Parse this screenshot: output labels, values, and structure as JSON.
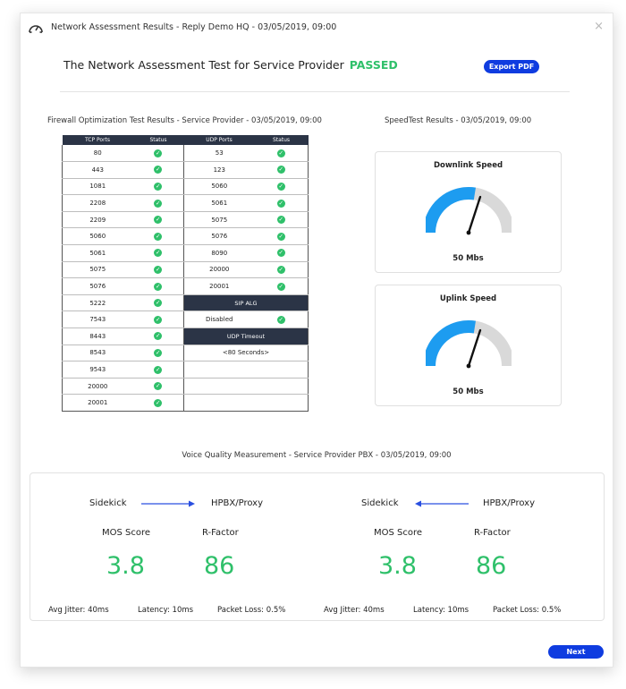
{
  "window": {
    "title": "Network Assessment Results -  Reply Demo HQ - 03/05/2019, 09:00",
    "close_label": "×"
  },
  "header": {
    "headline": "The Network Assessment Test for Service Provider",
    "status": "PASSED",
    "export_label": "Export PDF"
  },
  "firewall": {
    "title": "Firewall Optimization Test Results -  Service Provider - 03/05/2019, 09:00",
    "columns": [
      "TCP Ports",
      "Status",
      "UDP Ports",
      "Status"
    ],
    "tcp_ports": [
      "80",
      "443",
      "1081",
      "2208",
      "2209",
      "5060",
      "5061",
      "5075",
      "5076",
      "5222",
      "7543",
      "8443",
      "8543",
      "9543",
      "20000",
      "20001"
    ],
    "udp_ports": [
      "53",
      "123",
      "5060",
      "5061",
      "5075",
      "5076",
      "8090",
      "20000",
      "20001"
    ],
    "sip_alg_header": "SIP ALG",
    "sip_alg_value": "Disabled",
    "udp_timeout_header": "UDP Timeout",
    "udp_timeout_value": "<80 Seconds>",
    "check_glyph": "✓",
    "status_color": "#2fc06a"
  },
  "speedtest": {
    "title": "SpeedTest Results - 03/05/2019, 09:00",
    "downlink": {
      "title": "Downlink Speed",
      "value": "50 Mbs",
      "level": 0.55
    },
    "uplink": {
      "title": "Uplink Speed",
      "value": "50 Mbs",
      "level": 0.55
    },
    "gauge_fill_color": "#1d9cf0",
    "gauge_track_color": "#d9d9d9"
  },
  "voice": {
    "title": "Voice Quality Measurement - Service Provider PBX - 03/05/2019, 09:00",
    "panels": [
      {
        "from": "Sidekick",
        "to": "HPBX/Proxy",
        "direction": "right",
        "mos_label": "MOS Score",
        "mos_value": "3.8",
        "rfactor_label": "R-Factor",
        "rfactor_value": "86",
        "jitter": "Avg Jitter: 40ms",
        "latency": "Latency: 10ms",
        "packet_loss": "Packet Loss: 0.5%"
      },
      {
        "from": "Sidekick",
        "to": "HPBX/Proxy",
        "direction": "left",
        "mos_label": "MOS Score",
        "mos_value": "3.8",
        "rfactor_label": "R-Factor",
        "rfactor_value": "86",
        "jitter": "Avg Jitter: 40ms",
        "latency": "Latency: 10ms",
        "packet_loss": "Packet Loss: 0.5%"
      }
    ]
  },
  "footer": {
    "next_label": "Next"
  },
  "colors": {
    "accent": "#0f3ce0",
    "success": "#2fc06a",
    "table_header": "#2b3446"
  }
}
